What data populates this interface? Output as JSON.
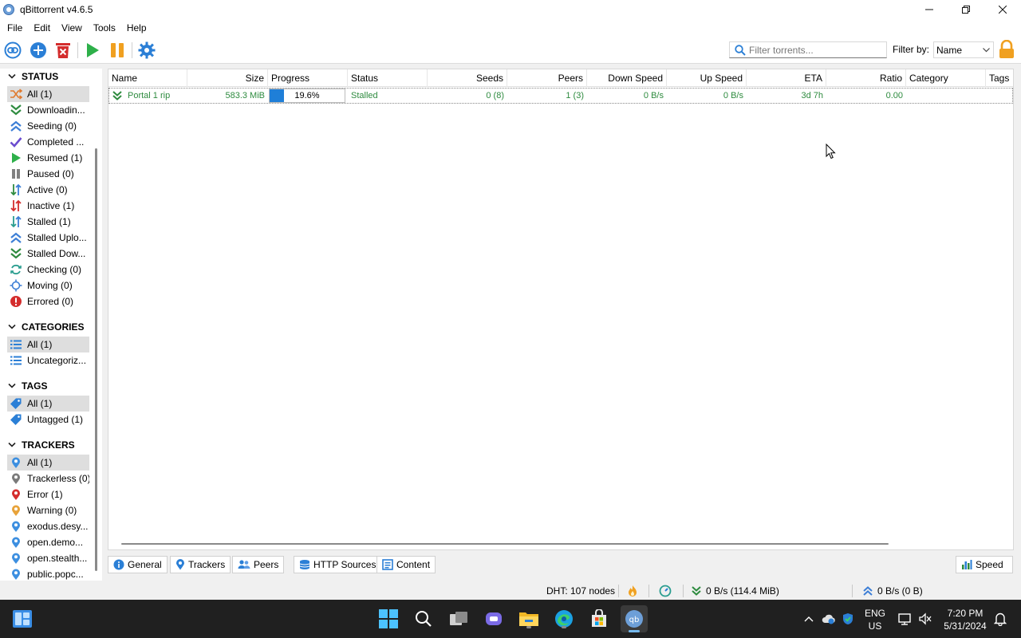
{
  "window": {
    "title": "qBittorrent v4.6.5"
  },
  "menu": [
    "File",
    "Edit",
    "View",
    "Tools",
    "Help"
  ],
  "toolbar": {
    "filter_placeholder": "Filter torrents...",
    "filter_label": "Filter by:",
    "filter_by_value": "Name"
  },
  "sidebar": {
    "status_title": "STATUS",
    "status_items": [
      {
        "label": "All (1)",
        "icon": "shuffle-icon",
        "color": "#e07a2e"
      },
      {
        "label": "Downloadin...",
        "icon": "download-chevron-icon",
        "color": "#2e8b3f"
      },
      {
        "label": "Seeding (0)",
        "icon": "upload-chevron-icon",
        "color": "#3d7fd6"
      },
      {
        "label": "Completed ...",
        "icon": "checkmark-icon",
        "color": "#6b4ccf"
      },
      {
        "label": "Resumed (1)",
        "icon": "play-icon",
        "color": "#2eb04a"
      },
      {
        "label": "Paused (0)",
        "icon": "pause-icon",
        "color": "#808080"
      },
      {
        "label": "Active (0)",
        "icon": "active-arrows-icon",
        "color": "#2e8b3f"
      },
      {
        "label": "Inactive (1)",
        "icon": "inactive-arrows-icon",
        "color": "#d42d2d"
      },
      {
        "label": "Stalled (1)",
        "icon": "stalled-arrows-icon",
        "color": "#3d7fd6"
      },
      {
        "label": "Stalled Uplo...",
        "icon": "stalled-upload-icon",
        "color": "#3d7fd6"
      },
      {
        "label": "Stalled Dow...",
        "icon": "stalled-download-icon",
        "color": "#2e8b3f"
      },
      {
        "label": "Checking (0)",
        "icon": "refresh-icon",
        "color": "#2a9d8f"
      },
      {
        "label": "Moving (0)",
        "icon": "moving-icon",
        "color": "#3d7fd6"
      },
      {
        "label": "Errored (0)",
        "icon": "error-icon",
        "color": "#d42d2d"
      }
    ],
    "categories_title": "CATEGORIES",
    "category_items": [
      {
        "label": "All (1)",
        "icon": "list-icon"
      },
      {
        "label": "Uncategoriz...",
        "icon": "list-icon"
      }
    ],
    "tags_title": "TAGS",
    "tag_items": [
      {
        "label": "All (1)",
        "icon": "tag-icon"
      },
      {
        "label": "Untagged (1)",
        "icon": "tag-icon"
      }
    ],
    "trackers_title": "TRACKERS",
    "tracker_items": [
      {
        "label": "All (1)",
        "icon": "pin-icon",
        "color": "#3d8fe0"
      },
      {
        "label": "Trackerless (0)",
        "icon": "pin-icon",
        "color": "#7a7a7a"
      },
      {
        "label": "Error (1)",
        "icon": "pin-icon",
        "color": "#d42d2d"
      },
      {
        "label": "Warning (0)",
        "icon": "pin-icon",
        "color": "#e8a33a"
      },
      {
        "label": "exodus.desy...",
        "icon": "pin-icon",
        "color": "#3d8fe0"
      },
      {
        "label": "open.demo...",
        "icon": "pin-icon",
        "color": "#3d8fe0"
      },
      {
        "label": "open.stealth...",
        "icon": "pin-icon",
        "color": "#3d8fe0"
      },
      {
        "label": "public.popc...",
        "icon": "pin-icon",
        "color": "#3d8fe0"
      }
    ]
  },
  "columns": [
    "Name",
    "Size",
    "Progress",
    "Status",
    "Seeds",
    "Peers",
    "Down Speed",
    "Up Speed",
    "ETA",
    "Ratio",
    "Category",
    "Tags"
  ],
  "torrents": [
    {
      "name": "Portal 1 rip",
      "size": "583.3 MiB",
      "progress": "19.6%",
      "progress_value": 0.196,
      "status": "Stalled",
      "seeds": "0 (8)",
      "peers": "1 (3)",
      "down_speed": "0 B/s",
      "up_speed": "0 B/s",
      "eta": "3d 7h",
      "ratio": "0.00",
      "category": "",
      "tags": ""
    }
  ],
  "tabs": [
    "General",
    "Trackers",
    "Peers",
    "HTTP Sources",
    "Content"
  ],
  "speed_button": "Speed",
  "statusbar": {
    "dht": "DHT: 107 nodes",
    "download": "0 B/s (114.4 MiB)",
    "upload": "0 B/s (0 B)"
  },
  "taskbar": {
    "lang_1": "ENG",
    "lang_2": "US",
    "time": "7:20 PM",
    "date": "5/31/2024"
  },
  "colors": {
    "accent": "#1f7fd8",
    "torrent_text": "#2e8b3f",
    "selection": "#dedede"
  }
}
